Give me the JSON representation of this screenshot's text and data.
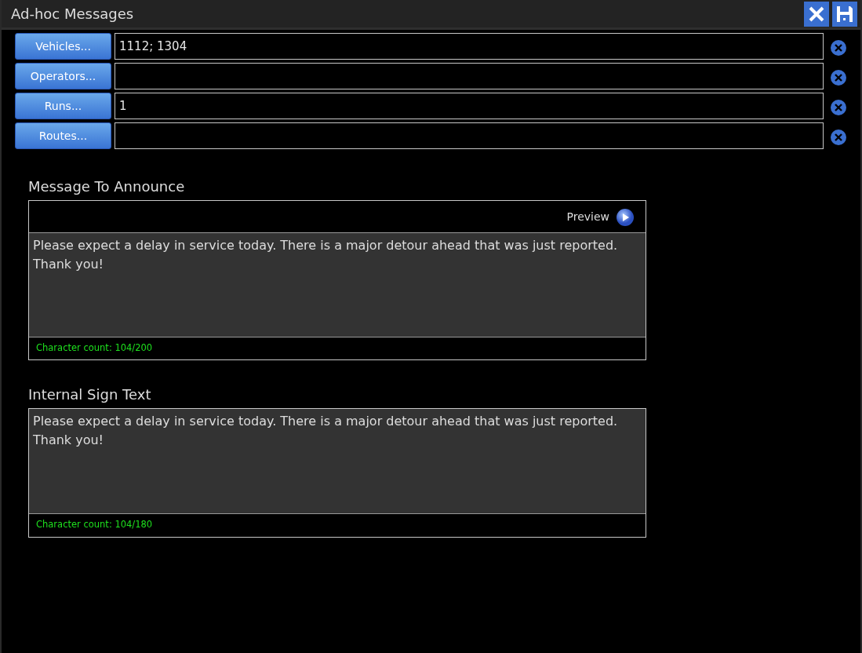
{
  "window": {
    "title": "Ad-hoc Messages"
  },
  "filters": [
    {
      "button": "Vehicles...",
      "value": "1112; 1304"
    },
    {
      "button": "Operators..."
    },
    {
      "button": "Runs...",
      "value": "1"
    },
    {
      "button": "Routes..."
    }
  ],
  "sections": [
    {
      "kind": "announce",
      "title": "Message To Announce",
      "preview": "Preview",
      "text": "Please expect a delay in service today. There is a major detour ahead that was just reported. Thank you!",
      "count": "Character count: 104/200"
    },
    {
      "kind": "sign",
      "title": "Internal Sign Text",
      "text": "Please expect a delay in service today. There is a major detour ahead that was just reported. Thank you!",
      "count": "Character count: 104/180"
    }
  ]
}
